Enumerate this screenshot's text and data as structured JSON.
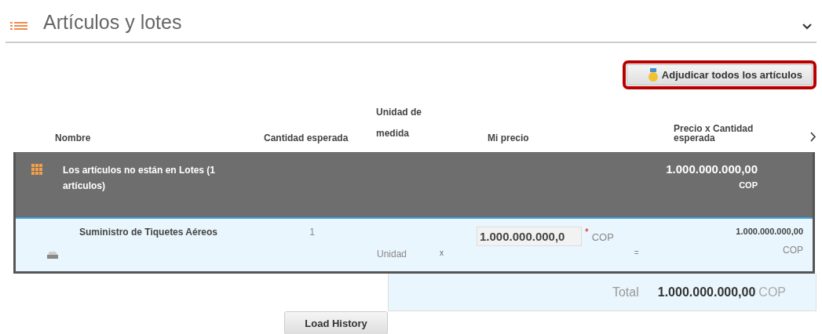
{
  "section": {
    "title": "Artículos y lotes",
    "expanded": true
  },
  "award_button": {
    "label": "Adjudicar todos los artículos",
    "highlighted": true
  },
  "columns": [
    "Nombre",
    "Cantidad esperada",
    "Unidad de medida",
    "Mi precio",
    "Precio x Cantidad esperada"
  ],
  "group": {
    "label": "Los artículos no están en Lotes (1 artículos)",
    "amount": "1.000.000.000,00",
    "currency": "COP"
  },
  "items": [
    {
      "name": "Suministro de Tiquetes Aéreos",
      "quantity": "1",
      "unit": "Unidad",
      "times": "x",
      "price": "1.000.000.000,0",
      "required_mark": "*",
      "price_currency": "COP",
      "equals": "=",
      "amount": "1.000.000.000,00",
      "currency": "COP"
    }
  ],
  "total": {
    "label": "Total",
    "amount": "1.000.000.000,00",
    "currency": "COP"
  },
  "load_history_button": "Load History"
}
